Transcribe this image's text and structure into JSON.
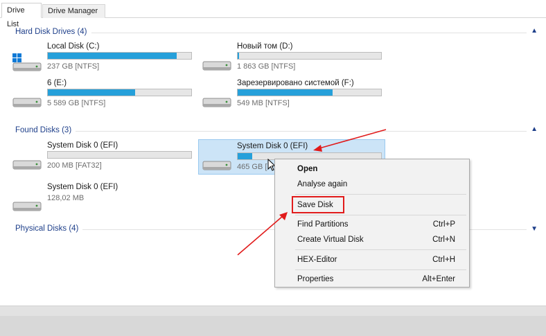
{
  "tabs": [
    {
      "label": "Drive List",
      "active": true
    },
    {
      "label": "Drive Manager",
      "active": false
    }
  ],
  "groups": {
    "hard_disks": {
      "title": "Hard Disk Drives (4)",
      "chevron": "chevron-up-icon"
    },
    "found_disks": {
      "title": "Found Disks (3)",
      "chevron": "chevron-up-icon"
    },
    "physical_disks": {
      "title": "Physical Disks (4)",
      "chevron": "chevron-down-icon"
    }
  },
  "drives": {
    "c": {
      "name": "Local Disk (C:)",
      "size": "237 GB [NTFS]",
      "used_fraction": 0.9,
      "icon": "windows-drive-icon"
    },
    "d": {
      "name": "Новый том (D:)",
      "size": "1 863 GB [NTFS]",
      "used_fraction": 0.01,
      "icon": "hard-drive-icon"
    },
    "e": {
      "name": "6 (E:)",
      "size": "5 589 GB [NTFS]",
      "used_fraction": 0.61,
      "icon": "hard-drive-icon"
    },
    "f": {
      "name": "Зарезервировано системой (F:)",
      "size": "549 MB [NTFS]",
      "used_fraction": 0.66,
      "icon": "hard-drive-icon"
    },
    "found1": {
      "name": "System Disk 0 (EFI)",
      "size": "200 MB [FAT32]",
      "used_fraction": 0.0,
      "icon": "hard-drive-icon"
    },
    "found2": {
      "name": "System Disk 0 (EFI)",
      "size": "465 GB [",
      "used_fraction": 0.1,
      "icon": "hard-drive-icon",
      "selected": true
    },
    "found3": {
      "name": "System Disk 0 (EFI)",
      "size": "128,02 MB",
      "icon": "hard-drive-icon"
    }
  },
  "context_menu": {
    "open": "Open",
    "analyse_again": "Analyse again",
    "save_disk": "Save Disk",
    "find_partitions": {
      "label": "Find Partitions",
      "shortcut": "Ctrl+P"
    },
    "create_virtual_disk": {
      "label": "Create Virtual Disk",
      "shortcut": "Ctrl+N"
    },
    "hex_editor": {
      "label": "HEX-Editor",
      "shortcut": "Ctrl+H"
    },
    "properties": {
      "label": "Properties",
      "shortcut": "Alt+Enter"
    }
  },
  "colors": {
    "accent_bar": "#26a0da",
    "group_header": "#1e3f8a",
    "selection": "#cce4f7",
    "annotation": "#e11b1b"
  }
}
